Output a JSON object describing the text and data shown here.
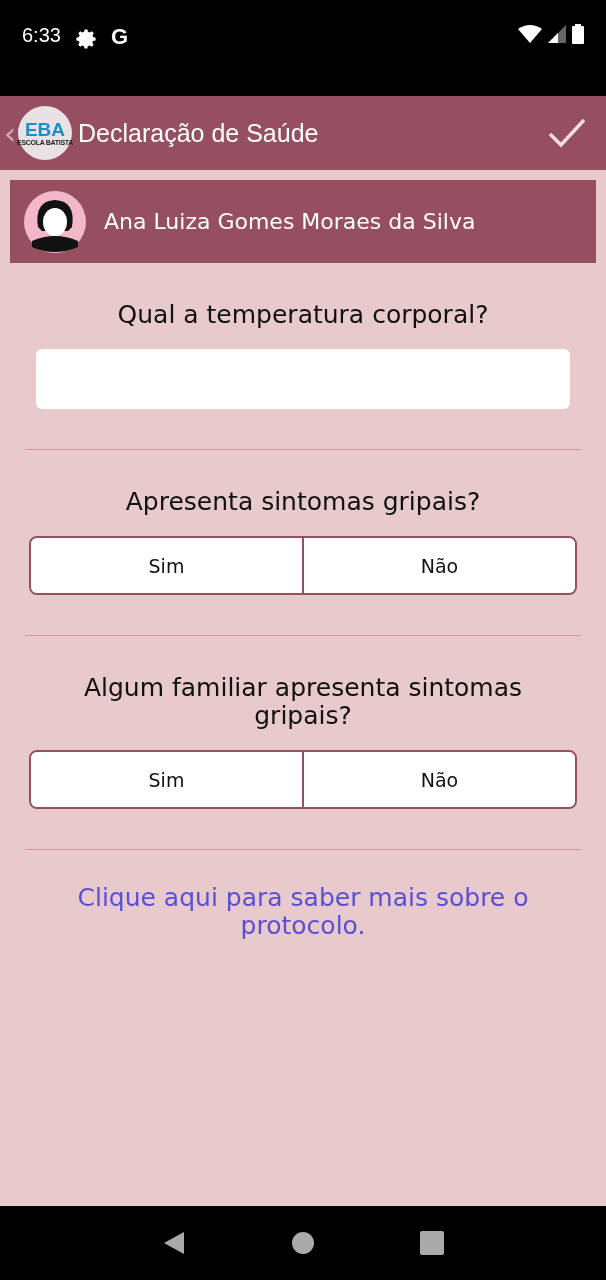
{
  "status_bar": {
    "time": "6:33",
    "google_glyph": "G"
  },
  "app_bar": {
    "back": "‹",
    "logo_text": "EBA",
    "logo_subtext": "ESCOLA BATISTA",
    "title": "Declaração de Saúde"
  },
  "student": {
    "name": "Ana Luiza Gomes Moraes da Silva"
  },
  "questions": [
    {
      "kind": "input",
      "label": "Qual a temperatura corporal?"
    },
    {
      "kind": "choice",
      "label": "Apresenta sintomas gripais?",
      "options": [
        {
          "label": "Sim",
          "selected": false
        },
        {
          "label": "Não",
          "selected": false
        }
      ]
    },
    {
      "kind": "choice",
      "label": "Algum familiar apresenta sintomas gripais?",
      "options": [
        {
          "label": "Sim",
          "selected": false
        },
        {
          "label": "Não",
          "selected": false
        }
      ]
    }
  ],
  "link": "Clique aqui para saber mais sobre o protocolo."
}
